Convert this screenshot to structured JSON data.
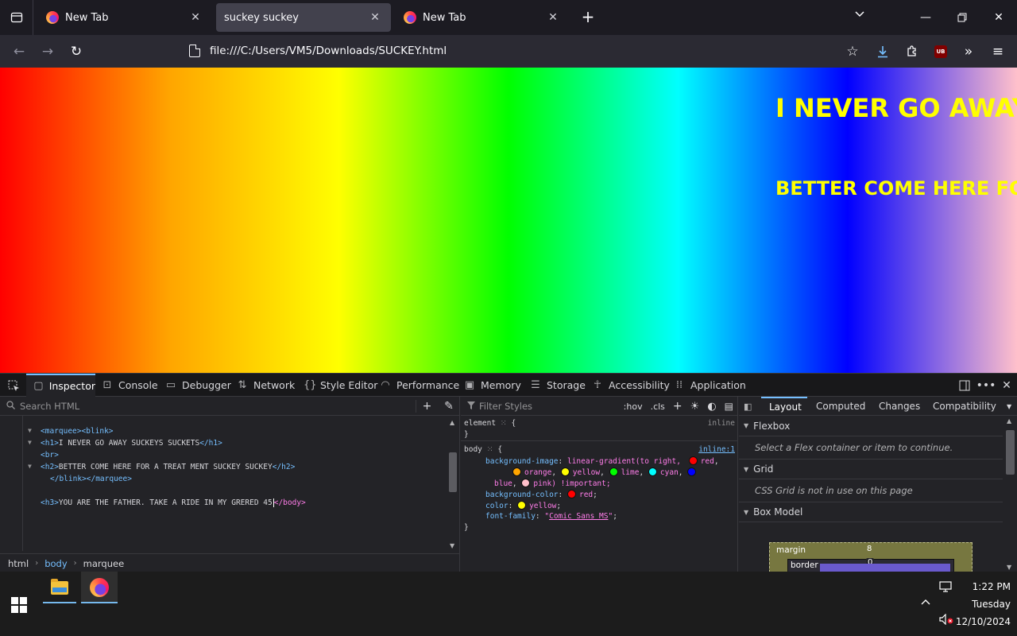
{
  "browser": {
    "tabs": [
      {
        "title": "New Tab",
        "active": false
      },
      {
        "title": "suckey suckey",
        "active": true
      },
      {
        "title": "New Tab",
        "active": false
      }
    ],
    "url": "file:///C:/Users/VM5/Downloads/SUCKEY.html"
  },
  "page": {
    "h1": "I NEVER GO AWAY SUCKEYS SUCKETS",
    "h2": "BETTER COME HERE FOR A TREAT MENT SUCKEY SUCKEY"
  },
  "devtools": {
    "tabs": [
      "Inspector",
      "Console",
      "Debugger",
      "Network",
      "Style Editor",
      "Performance",
      "Memory",
      "Storage",
      "Accessibility",
      "Application"
    ],
    "search_placeholder": "Search HTML",
    "markup": {
      "l1_tag": "<marquee><blink>",
      "l2_open": "<h1>",
      "l2_text": "I NEVER GO AWAY SUCKEYS SUCKETS",
      "l2_close": "</h1>",
      "l3_tag": "<br>",
      "l4_open": "<h2>",
      "l4_text": "BETTER COME HERE FOR A TREAT MENT SUCKEY SUCKEY",
      "l4_close": "</h2>",
      "l5_tag": "</blink></marquee>",
      "l6_open": "<h3>",
      "l6_text": "YOU ARE THE FATHER. TAKE A RIDE IN MY GRERED 45",
      "l6_close": "</body>"
    },
    "breadcrumbs": [
      "html",
      "body",
      "marquee"
    ],
    "rules": {
      "filter_placeholder": "Filter Styles",
      "hov": ":hov",
      "cls": ".cls",
      "element_selector": "element",
      "element_source": "inline",
      "body_selector": "body",
      "body_source": "inline:1",
      "bg_image_prop": "background-image",
      "bg_image_fn": "linear-gradient(to right,",
      "colors": [
        "red",
        "orange",
        "yellow",
        "lime",
        "cyan",
        "blue",
        "pink"
      ],
      "important": ") !important;",
      "bg_color_prop": "background-color",
      "bg_color_val": "red",
      "color_prop": "color",
      "color_val": "yellow",
      "font_prop": "font-family",
      "font_val": "Comic Sans MS"
    },
    "layout": {
      "tabs": [
        "Layout",
        "Computed",
        "Changes",
        "Compatibility"
      ],
      "flexbox_title": "Flexbox",
      "flexbox_note": "Select a Flex container or item to continue.",
      "grid_title": "Grid",
      "grid_note": "CSS Grid is not in use on this page",
      "boxmodel_title": "Box Model",
      "margin_label": "margin",
      "margin_value": "8",
      "border_label": "border",
      "border_value": "0"
    }
  },
  "taskbar": {
    "time": "1:22 PM",
    "day": "Tuesday",
    "date": "12/10/2024"
  }
}
